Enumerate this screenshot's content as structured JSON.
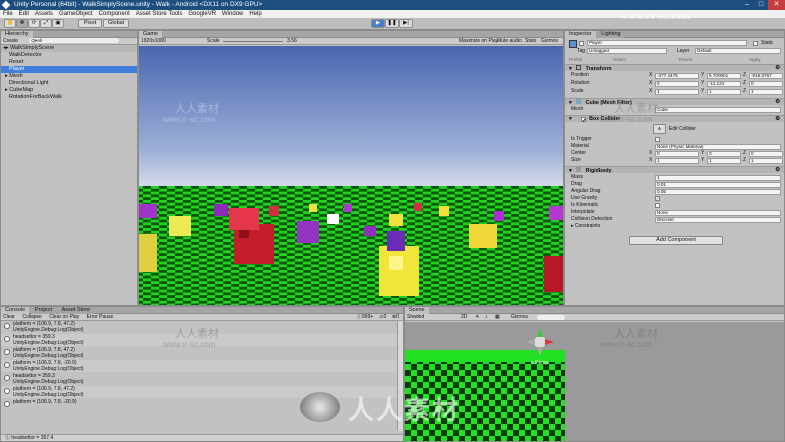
{
  "window": {
    "title": "Unity Personal (64bit) - WalkSimplyScene.unity - Walk - Android <DX11 on DX9 GPU>"
  },
  "menu": [
    "File",
    "Edit",
    "Assets",
    "GameObject",
    "Component",
    "Asset Store Tools",
    "GoogleVR",
    "Window",
    "Help"
  ],
  "toolbar": {
    "pivot": "Pivot",
    "global": "Global",
    "play": "▶",
    "pause": "❚❚",
    "step": "▶|"
  },
  "hierarchy": {
    "tab": "Hierarchy",
    "create": "Create",
    "search_placeholder": "Q▾All",
    "scene": "WalkSimplyScene",
    "items": [
      {
        "label": "WalkDetector",
        "selected": false
      },
      {
        "label": "Reset",
        "selected": false
      },
      {
        "label": "Player",
        "selected": true
      },
      {
        "label": "Mesh",
        "selected": false
      },
      {
        "label": "Directional Light",
        "selected": false
      },
      {
        "label": "CubeMap",
        "selected": false
      },
      {
        "label": "RotationForBackWalk",
        "selected": false
      }
    ]
  },
  "game": {
    "tab": "Game",
    "resolution": "1920x1080",
    "scale_label": "Scale",
    "scale_value": "3.56",
    "options": [
      "Maximize on Play",
      "Mute audio",
      "Stats",
      "Gizmos"
    ]
  },
  "console": {
    "tabs": [
      "Console",
      "Project",
      "Asset Store"
    ],
    "buttons": [
      "Clear",
      "Collapse",
      "Clear on Play",
      "Error Pause"
    ],
    "counts": [
      "999+",
      "0",
      "0"
    ],
    "entries": [
      {
        "line1": "platform = (106.9, 7.8, 47.2)",
        "line2": "UnityEngine.Debug:Log(Object)"
      },
      {
        "line1": "headsettor = 359.3",
        "line2": "UnityEngine.Debug:Log(Object)"
      },
      {
        "line1": "platform = (106.9, 7.8, 47.2)",
        "line2": "UnityEngine.Debug:Log(Object)"
      },
      {
        "line1": "platform = (106.9, 7.8, -20.9)",
        "line2": "UnityEngine.Debug:Log(Object)"
      },
      {
        "line1": "headsettor = 359.3",
        "line2": "UnityEngine.Debug:Log(Object)"
      },
      {
        "line1": "platform = (106.9, 7.8, 47.2)",
        "line2": "UnityEngine.Debug:Log(Object)"
      },
      {
        "line1": "platform = (106.9, 7.8, -20.9)",
        "line2": ""
      }
    ],
    "status": "headsettor = 357.4"
  },
  "scene": {
    "tabs": [
      "Scene"
    ],
    "shaded": "Shaded",
    "mode2d": "2D",
    "gizmos": "Gizmos",
    "persp": "≤ Persp"
  },
  "inspector": {
    "tabs": [
      "Inspector",
      "Lighting"
    ],
    "name": "Player",
    "static": "Static",
    "tag_label": "Tag",
    "tag": "Untagged",
    "layer_label": "Layer",
    "layer": "Default",
    "prefab": [
      "Prefab",
      "Select",
      "Revert",
      "Apply"
    ],
    "transform": {
      "title": "Transform",
      "rows": [
        {
          "label": "Position",
          "x": "-377.4475",
          "y": "5.700001",
          "z": "-916.0767"
        },
        {
          "label": "Rotation",
          "x": "0",
          "y": "-11.124",
          "z": "0"
        },
        {
          "label": "Scale",
          "x": "1",
          "y": "1",
          "z": "1"
        }
      ]
    },
    "meshfilter": {
      "title": "Cube (Mesh Filter)",
      "mesh_label": "Mesh",
      "mesh": "Cube"
    },
    "boxcollider": {
      "title": "Box Collider",
      "edit": "Edit Collider",
      "is_trigger": "Is Trigger",
      "material_label": "Material",
      "material": "None (Physic Material)",
      "center_label": "Center",
      "center": [
        "0",
        "0",
        "0"
      ],
      "size_label": "Size",
      "size": [
        "1",
        "1",
        "1"
      ]
    },
    "rigidbody": {
      "title": "Rigidbody",
      "rows": [
        {
          "label": "Mass",
          "value": "1"
        },
        {
          "label": "Drag",
          "value": "0.01"
        },
        {
          "label": "Angular Drag",
          "value": "0.05"
        }
      ],
      "use_gravity": "Use Gravity",
      "is_kinematic": "Is Kinematic",
      "interpolate_label": "Interpolate",
      "interpolate": "None",
      "collision_label": "Collision Detection",
      "collision": "Discrete",
      "constraints": "Constraints"
    },
    "add_component": "Add Component"
  },
  "watermark": {
    "cn": "人人素材",
    "url": "www.rr-sc.com"
  },
  "colors": {
    "selection": "#3e7ddb",
    "sky_top": "#4f6fb6",
    "sky_bottom": "#d4d9e6",
    "floor_green": "#1ed21e",
    "floor_dark": "#0a3d0a",
    "title_bar": "#1e4e80"
  }
}
